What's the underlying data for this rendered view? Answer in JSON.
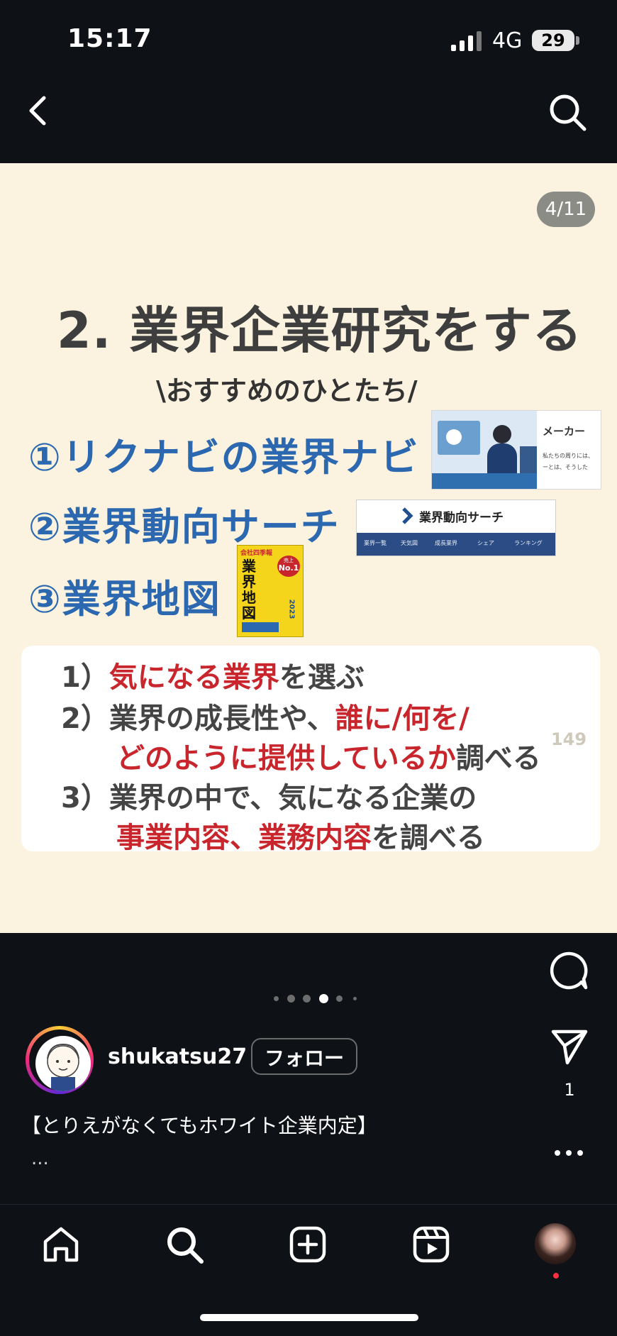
{
  "status": {
    "time": "15:17",
    "network": "4G",
    "battery": "29"
  },
  "post": {
    "counter": "4/11",
    "title": "2. 業界企業研究をする",
    "subtitle": "\\おすすめのひとたち/",
    "items": [
      "①リクナビの業界ナビ",
      "②業界動向サーチ",
      "③業界地図"
    ],
    "thumb_rikunabi": {
      "label": "メーカー",
      "text1": "私たちの周りには、",
      "text2": "ーとは、そうした"
    },
    "thumb_trend": {
      "title": "業界動向サーチ",
      "menu": [
        "業界一覧",
        "天気図",
        "成長業界",
        "シェア",
        "ランキング"
      ]
    },
    "thumb_book": {
      "header": "会社四季報",
      "badge_top": "売上",
      "badge_main": "No.1",
      "title": "業界地図",
      "year": "2023"
    },
    "steps": {
      "s1_num": "1）",
      "s1_red": "気になる業界",
      "s1_rest": "を選ぶ",
      "s2_num": "2）",
      "s2_a": "業界の成長性や、",
      "s2_red1": "誰に/何を/",
      "s2_red2": "どのように提供しているか",
      "s2_rest": "調べる",
      "s3_num": "3）",
      "s3_a": "業界の中で、気になる企業の",
      "s3_red": "事業内容、業務内容",
      "s3_rest": "を調べる"
    },
    "likes": "149"
  },
  "account": {
    "username": "shukatsu27",
    "follow_label": "フォロー"
  },
  "share_count": "1",
  "caption": "【とりえがなくてもホワイト企業内定】",
  "caption_more": "...",
  "carousel": {
    "total": 6,
    "active": 3
  },
  "icons": {
    "back": "back-arrow-icon",
    "search": "search-icon",
    "heart": "heart-icon",
    "comment": "comment-icon",
    "share": "send-icon",
    "more": "more-icon",
    "home": "home-icon",
    "create": "create-icon",
    "reels": "reels-icon"
  },
  "colors": {
    "accent_blue": "#2c68b0",
    "accent_red": "#c8262c",
    "slide_bg": "#fbf3df"
  }
}
